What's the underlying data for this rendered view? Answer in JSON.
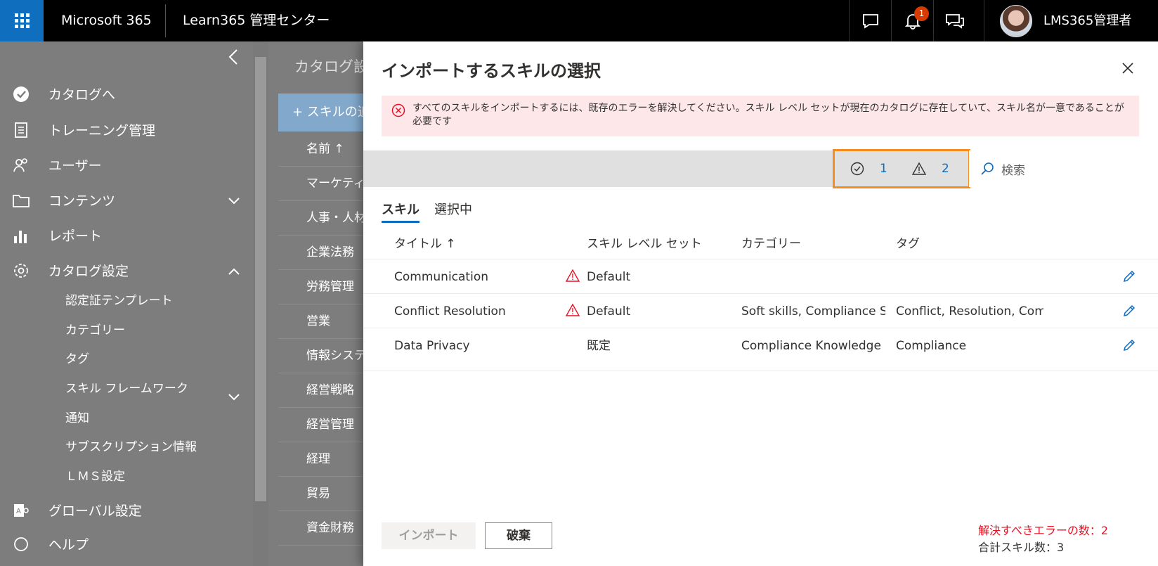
{
  "topbar": {
    "brand": "Microsoft 365",
    "app_title": "Learn365 管理センター",
    "notification_count": "1",
    "user_name": "LMS365管理者"
  },
  "leftnav": {
    "items": [
      {
        "label": "カタログへ",
        "icon": "check-circle-icon"
      },
      {
        "label": "トレーニング管理",
        "icon": "clipboard-icon"
      },
      {
        "label": "ユーザー",
        "icon": "users-icon"
      },
      {
        "label": "コンテンツ",
        "icon": "folder-icon"
      },
      {
        "label": "レポート",
        "icon": "bar-chart-icon"
      },
      {
        "label": "カタログ設定",
        "icon": "gear-icon"
      }
    ],
    "sub_items": [
      "認定証テンプレート",
      "カテゴリー",
      "タグ",
      "スキル フレームワーク",
      "通知",
      "サブスクリプション情報",
      "ＬＭＳ設定"
    ],
    "global_label": "グローバル設定",
    "help_label": "ヘルプ"
  },
  "middle": {
    "title": "カタログ設定",
    "add_button": "+ スキルの追加",
    "column_header": "名前 ↑",
    "rows": [
      "マーケティング",
      "人事・人材",
      "企業法務",
      "労務管理",
      "営業",
      "情報システム",
      "経営戦略",
      "経営管理",
      "経理",
      "貿易",
      "資金財務"
    ]
  },
  "panel": {
    "title": "インポートするスキルの選択",
    "error_message": "すべてのスキルをインポートするには、既存のエラーを解決してください。スキル レベル セットが現在のカタログに存在していて、スキル名が一意であることが必要です",
    "ok_count": "1",
    "warning_count": "2",
    "search_label": "検索",
    "tabs": [
      "スキル",
      "選択中"
    ],
    "columns": [
      "タイトル ↑",
      "スキル レベル セット",
      "カテゴリー",
      "タグ"
    ],
    "rows": [
      {
        "title": "Communication",
        "level_set": "Default",
        "category": "",
        "tags": "",
        "warning": true
      },
      {
        "title": "Conflict Resolution",
        "level_set": "Default",
        "category": "Soft skills, Compliance Stra...",
        "tags": "Conflict, Resolution, Compl...",
        "warning": true
      },
      {
        "title": "Data Privacy",
        "level_set": "既定",
        "category": "Compliance Knowledge",
        "tags": "Compliance",
        "warning": false
      }
    ],
    "import_button": "インポート",
    "discard_button": "破棄",
    "error_count_text": "解決すべきエラーの数：2",
    "total_count_text": "合計スキル数：3"
  },
  "colors": {
    "accent": "#0f6cbd",
    "highlight_border": "#f68b1f",
    "error_bg": "#fde7e9",
    "error_text": "#e81123",
    "warning_icon": "#e81123"
  }
}
